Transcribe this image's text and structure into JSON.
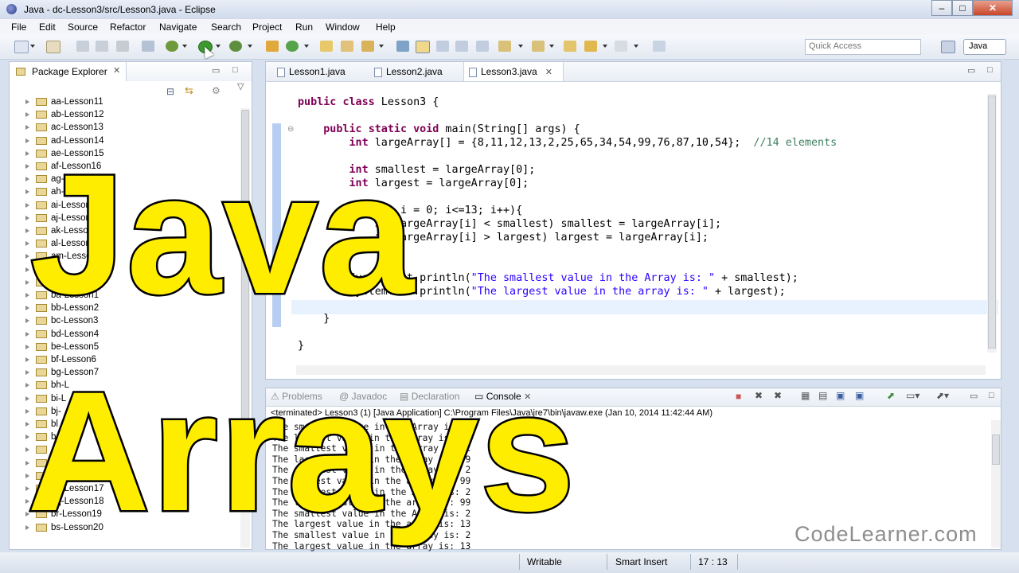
{
  "window": {
    "title": "Java - dc-Lesson3/src/Lesson3.java - Eclipse"
  },
  "menu": [
    "File",
    "Edit",
    "Source",
    "Refactor",
    "Navigate",
    "Search",
    "Project",
    "Run",
    "Window",
    "Help"
  ],
  "toolbar": {
    "quick_access_placeholder": "Quick Access",
    "perspective": "Java"
  },
  "package_explorer": {
    "title": "Package Explorer",
    "items": [
      "aa-Lesson11",
      "ab-Lesson12",
      "ac-Lesson13",
      "ad-Lesson14",
      "ae-Lesson15",
      "af-Lesson16",
      "ag-Lesson17",
      "ah-Lesson",
      "ai-Lesson",
      "aj-Lesson",
      "ak-Lesson",
      "al-Lesson",
      "am-Lesson",
      "",
      "",
      "ba-Lesson1",
      "bb-Lesson2",
      "bc-Lesson3",
      "bd-Lesson4",
      "be-Lesson5",
      "bf-Lesson6",
      "bg-Lesson7",
      "bh-L",
      "bi-L",
      "bj-",
      "bl",
      "b",
      "",
      "",
      "",
      "bq-Lesson17",
      "bq-Lesson18",
      "br-Lesson19",
      "bs-Lesson20"
    ]
  },
  "editor": {
    "tabs": [
      "Lesson1.java",
      "Lesson2.java",
      "Lesson3.java"
    ],
    "active_tab": "Lesson3.java"
  },
  "console": {
    "tabs": [
      "Problems",
      "Javadoc",
      "Declaration",
      "Console"
    ],
    "terminated": "<terminated> Lesson3 (1) [Java Application] C:\\Program Files\\Java\\jre7\\bin\\javaw.exe (Jan 10, 2014 11:42:44 AM)",
    "lines": [
      "The smallest value in the Array is: 2",
      "The largest value in the array is: 99",
      "The smallest value in the Array is: 2",
      "The largest value in the array is: 99",
      "The smallest value in the Array is: 2",
      "The largest value in the array is: 99",
      "The smallest value in the Array is: 2",
      "The largest value in the array is: 99",
      "The smallest value in the Array is: 2",
      "The largest value in the array is: 13",
      "The smallest value in the Array is: 2",
      "The largest value in the array is: 13"
    ]
  },
  "status": {
    "writable": "Writable",
    "insert_mode": "Smart Insert",
    "position": "17 : 13"
  },
  "overlay": {
    "line1": "Java",
    "line2": "Arrays",
    "watermark": "CodeLearner.com"
  }
}
